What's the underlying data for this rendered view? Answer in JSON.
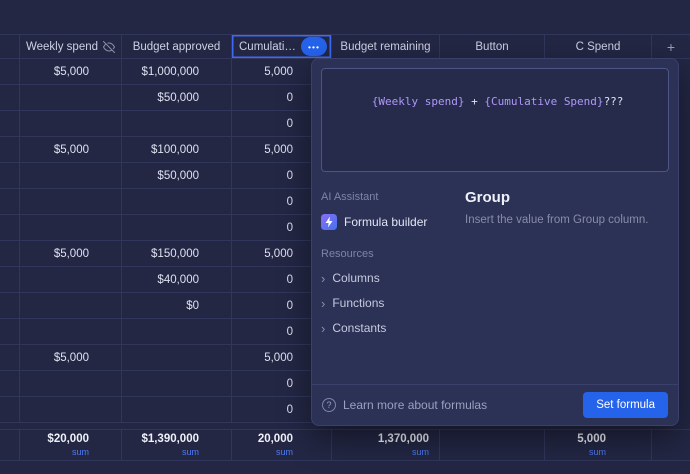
{
  "colors": {
    "accent_blue": "#3E6AF3",
    "button_blue": "#2563EB",
    "token_purple": "#AF97F8",
    "sum_blue": "#4E7AF5"
  },
  "icons": {
    "column_menu_icon": "•••",
    "add_column_icon": "+",
    "chevron_icon": "›",
    "help_icon": "?",
    "eye_off_icon": "eye-off"
  },
  "table": {
    "columns": [
      {
        "label": "Weekly spend"
      },
      {
        "label": "Budget approved"
      },
      {
        "label": "Cumulative …",
        "selected": true
      },
      {
        "label": "Budget remaining"
      },
      {
        "label": "Button"
      },
      {
        "label": "C Spend"
      }
    ],
    "rows": [
      [
        "$5,000",
        "$1,000,000",
        "5,000"
      ],
      [
        "",
        "$50,000",
        "0"
      ],
      [
        "",
        "",
        "0"
      ],
      [
        "$5,000",
        "$100,000",
        "5,000"
      ],
      [
        "",
        "$50,000",
        "0"
      ],
      [
        "",
        "",
        "0"
      ],
      [
        "",
        "",
        "0"
      ],
      [
        "$5,000",
        "$150,000",
        "5,000"
      ],
      [
        "",
        "$40,000",
        "0"
      ],
      [
        "",
        "$0",
        "0"
      ],
      [
        "",
        "",
        "0"
      ],
      [
        "$5,000",
        "",
        "5,000"
      ],
      [
        "",
        "",
        "0"
      ],
      [
        "",
        "",
        "0"
      ]
    ],
    "summary": [
      {
        "value": "$20,000",
        "label": "sum"
      },
      {
        "value": "$1,390,000",
        "label": "sum"
      },
      {
        "value": "20,000",
        "label": "sum"
      },
      {
        "value": "1,370,000",
        "label": "sum"
      },
      {
        "value": "",
        "label": ""
      },
      {
        "value": "5,000",
        "label": "sum"
      }
    ]
  },
  "formula_panel": {
    "tokens": [
      {
        "text": "{Weekly spend}",
        "type": "field"
      },
      {
        "text": " + ",
        "type": "op"
      },
      {
        "text": "{Cumulative Spend}",
        "type": "field"
      },
      {
        "text": "???",
        "type": "plain"
      }
    ],
    "ai_assistant_label": "AI Assistant",
    "formula_builder_label": "Formula builder",
    "resources_label": "Resources",
    "resources": [
      {
        "label": "Columns"
      },
      {
        "label": "Functions"
      },
      {
        "label": "Constants"
      }
    ],
    "detail_title": "Group",
    "detail_description": "Insert the value from Group column.",
    "learn_more_label": "Learn more about formulas",
    "set_formula_label": "Set formula"
  }
}
